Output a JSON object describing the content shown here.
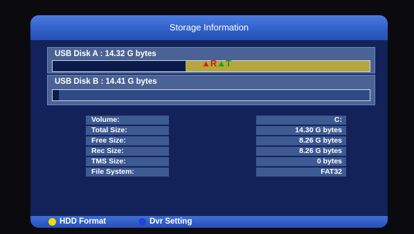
{
  "window": {
    "title": "Storage Information"
  },
  "disks": {
    "a": {
      "label": "USB Disk A : 14.32 G bytes",
      "used_fraction": 0.42,
      "overlay_text": "▲R▲T"
    },
    "b": {
      "label": "USB Disk B : 14.41 G bytes",
      "used_fraction": 0.02
    }
  },
  "info": {
    "rows": [
      {
        "label": "Volume:",
        "value": "C:"
      },
      {
        "label": "Total Size:",
        "value": "14.30 G bytes"
      },
      {
        "label": "Free Size:",
        "value": "8.26 G bytes"
      },
      {
        "label": "Rec Size:",
        "value": "8.26 G bytes"
      },
      {
        "label": "TMS Size:",
        "value": "0 bytes"
      },
      {
        "label": "File System:",
        "value": "FAT32"
      }
    ]
  },
  "footer": {
    "yellow_button": "HDD Format",
    "blue_button": "Dvr Setting",
    "yellow_color": "#f5d90a",
    "blue_color": "#2a3fd8"
  }
}
